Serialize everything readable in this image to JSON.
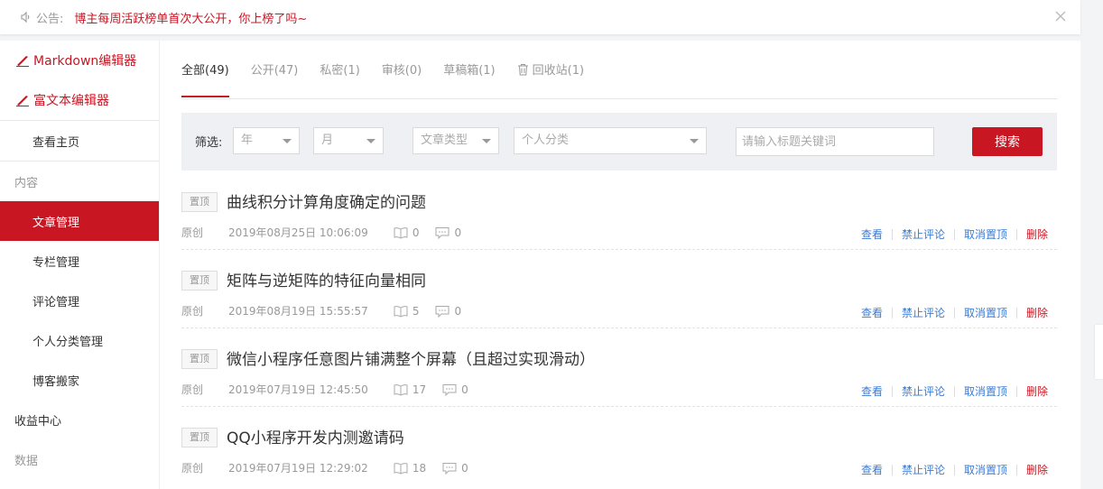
{
  "notice": {
    "label": "公告:",
    "text": "博主每周活跃榜单首次大公开，你上榜了吗~"
  },
  "sidebar": {
    "editors": [
      "Markdown编辑器",
      "富文本编辑器"
    ],
    "home": "查看主页",
    "content_group": "内容",
    "items": [
      "文章管理",
      "专栏管理",
      "评论管理",
      "个人分类管理",
      "博客搬家"
    ],
    "income": "收益中心",
    "data_group": "数据"
  },
  "tabs": [
    {
      "label": "全部(49)"
    },
    {
      "label": "公开(47)"
    },
    {
      "label": "私密(1)"
    },
    {
      "label": "审核(0)"
    },
    {
      "label": "草稿箱(1)"
    },
    {
      "label": "回收站(1)"
    }
  ],
  "filter": {
    "label": "筛选:",
    "year": "年",
    "month": "月",
    "type": "文章类型",
    "category": "个人分类",
    "keyword_placeholder": "请输入标题关键词",
    "search_label": "搜索"
  },
  "articles": [
    {
      "pin": "置顶",
      "title": "曲线积分计算角度确定的问题",
      "origin": "原创",
      "date": "2019年08月25日 10:06:09",
      "reads": "0",
      "comments": "0"
    },
    {
      "pin": "置顶",
      "title": "矩阵与逆矩阵的特征向量相同",
      "origin": "原创",
      "date": "2019年08月19日 15:55:57",
      "reads": "5",
      "comments": "0"
    },
    {
      "pin": "置顶",
      "title": "微信小程序任意图片铺满整个屏幕（且超过实现滑动）",
      "origin": "原创",
      "date": "2019年07月19日 12:45:50",
      "reads": "17",
      "comments": "0"
    },
    {
      "pin": "置顶",
      "title": "QQ小程序开发内测邀请码",
      "origin": "原创",
      "date": "2019年07月19日 12:29:02",
      "reads": "18",
      "comments": "0"
    }
  ],
  "ops": {
    "view": "查看",
    "forbid_comment": "禁止评论",
    "unpin": "取消置顶",
    "delete": "删除"
  },
  "colors": {
    "accent": "#c81623",
    "link": "#3a7bd5"
  }
}
